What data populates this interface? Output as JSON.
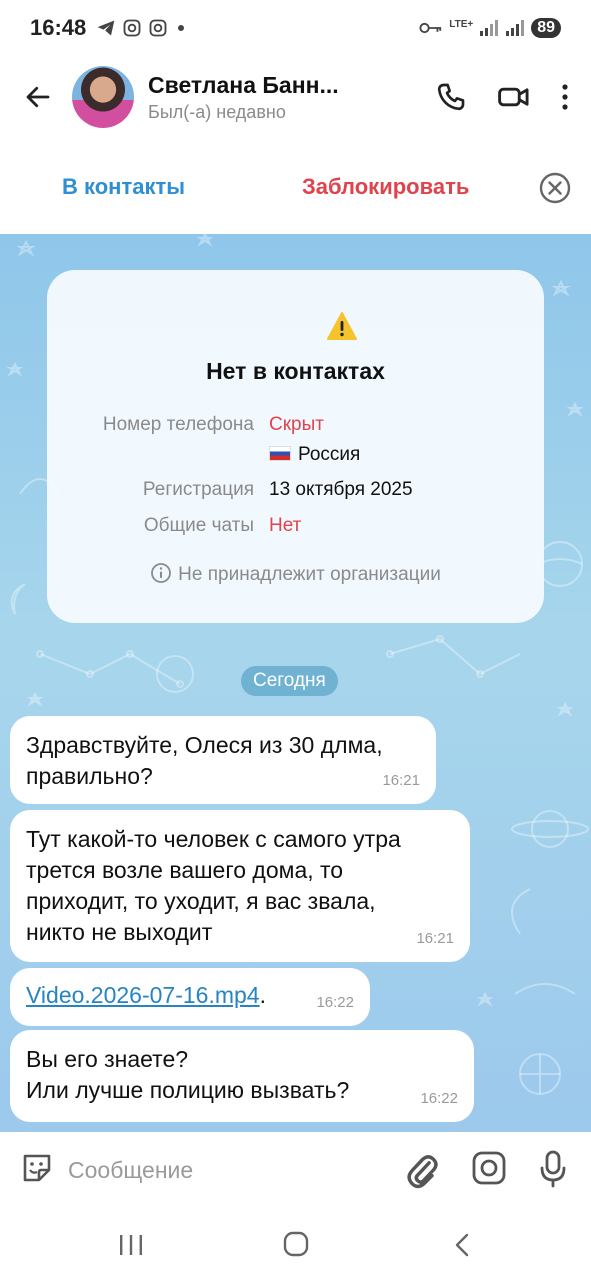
{
  "status_bar": {
    "time": "16:48",
    "network": "LTE+",
    "battery": "89",
    "icons": [
      "telegram-icon",
      "instagram-icon",
      "instagram-icon",
      "notification-dot",
      "key-icon",
      "signal-icon",
      "signal-icon"
    ]
  },
  "header": {
    "contact_name": "Светлана Банн...",
    "contact_status": "Был(-а) недавно",
    "icons": [
      "back-arrow-icon",
      "phone-icon",
      "video-camera-icon",
      "more-vertical-icon"
    ]
  },
  "action_bar": {
    "add_contact": "В контакты",
    "block": "Заблокировать"
  },
  "info_card": {
    "title": "Нет в контактах",
    "phone_label": "Номер телефона",
    "phone_value": "Скрыт",
    "country": "Россия",
    "registration_label": "Регистрация",
    "registration_value": "13 октября 2025",
    "common_chats_label": "Общие чаты",
    "common_chats_value": "Нет",
    "organization_note": "Не принадлежит организации"
  },
  "chat": {
    "date_separator": "Сегодня",
    "messages": [
      {
        "text": "Здравствуйте, Олеся из 30 длма,\nправильно?",
        "time": "16:21"
      },
      {
        "text": "Тут какой-то человек с самого утра\nтрется возле вашего дома, то\nприходит, то уходит, я вас звала,\nникто не выходит",
        "time": "16:21"
      },
      {
        "link": "Video.2026-07-16.mp4",
        "suffix": ".",
        "time": "16:22"
      },
      {
        "text": "Вы его знаете?\nИли лучше полицию вызвать?",
        "time": "16:22"
      }
    ]
  },
  "composer": {
    "placeholder": "Сообщение",
    "icons": [
      "sticker-icon",
      "paperclip-icon",
      "camera-icon",
      "microphone-icon"
    ]
  },
  "colors": {
    "accent_blue": "#2f8fd1",
    "danger_red": "#e0434c",
    "chat_bg": "#9ccbea",
    "link": "#2684c3"
  }
}
